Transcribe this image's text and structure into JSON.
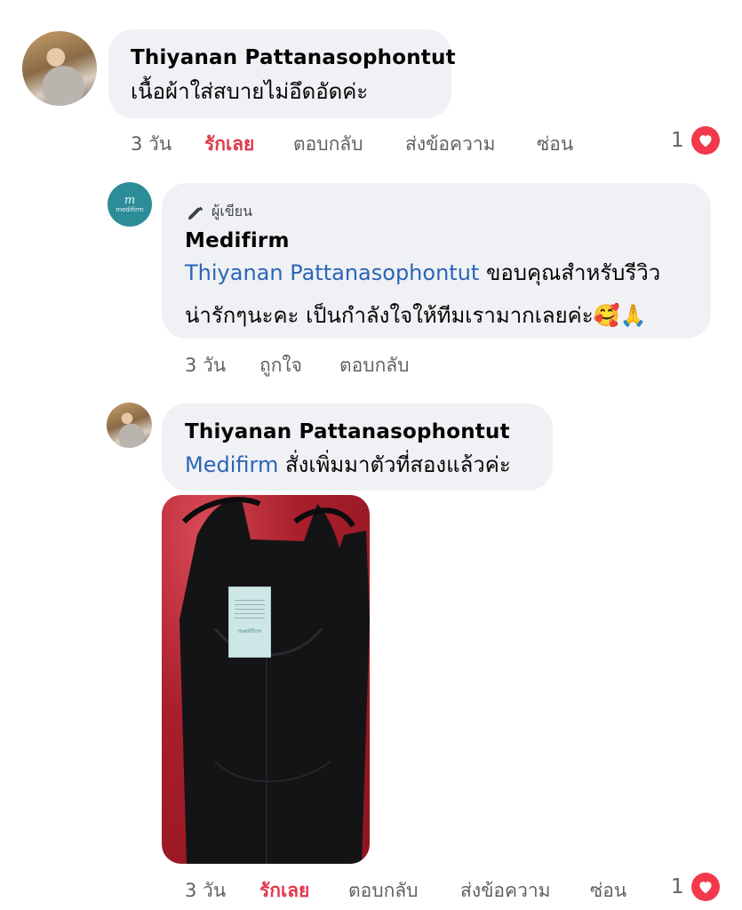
{
  "comments": [
    {
      "author": "Thiyanan Pattanasophontut",
      "text": "เนื้อผ้าใส่สบายไม่อึดอัดค่ะ",
      "time": "3 วัน",
      "like_label": "รักเลย",
      "reply_label": "ตอบกลับ",
      "message_label": "ส่งข้อความ",
      "hide_label": "ซ่อน",
      "reaction_count": "1"
    },
    {
      "badge_label": "ผู้เขียน",
      "author": "Medifirm",
      "mention": "Thiyanan Pattanasophontut",
      "text_line1": " ขอบคุณสำหรับรีวิว",
      "text_line2": "น่ารักๆนะคะ เป็นกำลังใจให้ทีมเรามากเลยค่ะ",
      "emojis": "🥰🙏",
      "time": "3 วัน",
      "like_label": "ถูกใจ",
      "reply_label": "ตอบกลับ",
      "avatar_text": "medifirm"
    },
    {
      "author": "Thiyanan Pattanasophontut",
      "mention": "Medifirm",
      "text": " สั่งเพิ่มมาตัวที่สองแล้วค่ะ",
      "time": "3 วัน",
      "like_label": "รักเลย",
      "reply_label": "ตอบกลับ",
      "message_label": "ส่งข้อความ",
      "hide_label": "ซ่อน",
      "reaction_count": "1",
      "photo_tag_text": "medifirm"
    }
  ],
  "colors": {
    "bubble": "#eff1f4",
    "mention": "#2c64b8",
    "loved": "#e0384a",
    "heart": "#f2394c"
  },
  "icons": [
    "heart-icon",
    "pen-icon"
  ]
}
